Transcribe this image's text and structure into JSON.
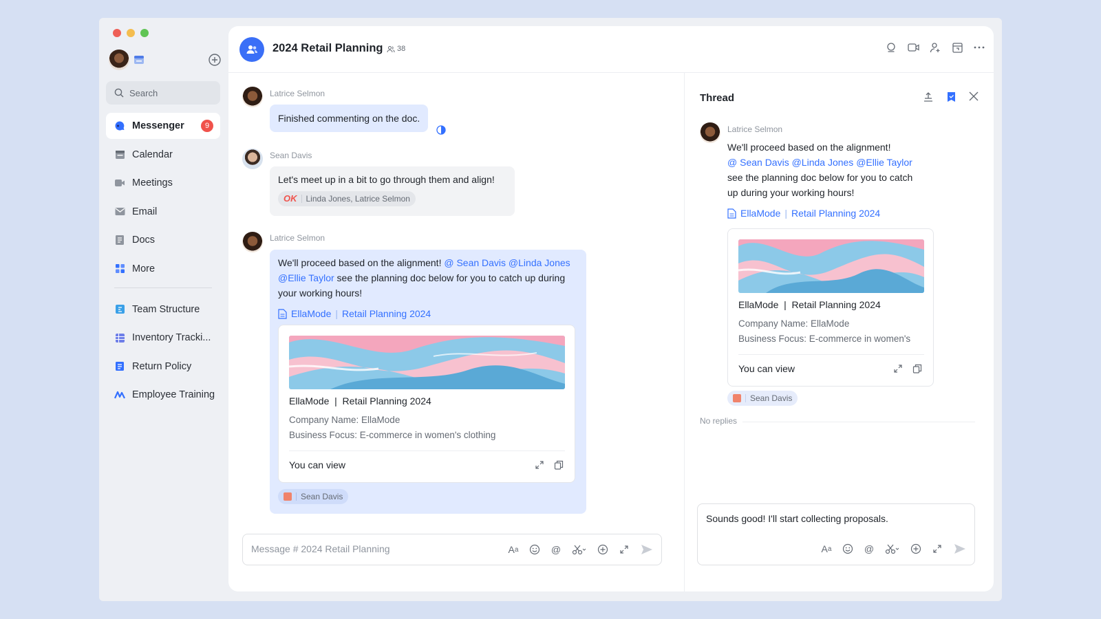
{
  "window": {
    "traffic_colors": [
      "#ee5f57",
      "#f4bd4f",
      "#5fc454"
    ]
  },
  "sidebar": {
    "search_placeholder": "Search",
    "items": [
      {
        "label": "Messenger",
        "icon": "messenger-icon",
        "badge": "9",
        "active": true
      },
      {
        "label": "Calendar",
        "icon": "calendar-icon"
      },
      {
        "label": "Meetings",
        "icon": "video-icon"
      },
      {
        "label": "Email",
        "icon": "mail-icon"
      },
      {
        "label": "Docs",
        "icon": "docs-icon"
      },
      {
        "label": "More",
        "icon": "grid-icon"
      }
    ],
    "pinned": [
      {
        "label": "Team Structure",
        "icon": "org-icon"
      },
      {
        "label": "Inventory Tracki...",
        "icon": "sheet-icon"
      },
      {
        "label": "Return Policy",
        "icon": "doc-icon"
      },
      {
        "label": "Employee Training",
        "icon": "training-icon"
      }
    ]
  },
  "header": {
    "title": "2024 Retail Planning",
    "member_count": "38"
  },
  "messages": {
    "m1": {
      "sender": "Latrice Selmon",
      "text": "Finished commenting on the doc."
    },
    "m2": {
      "sender": "Sean Davis",
      "text": "Let's meet up in a bit to go through them and align!",
      "reaction_emoji": "OK",
      "reaction_users": "Linda Jones, Latrice Selmon"
    },
    "m3": {
      "sender": "Latrice Selmon",
      "text_1": "We'll proceed based on the alignment! ",
      "mention_1": "@ Sean Davis",
      "mention_2": " @Linda Jones",
      "mention_3": "@Ellie Taylor",
      "text_2": " see the planning doc below for you to catch up during",
      "text_3": "your working hours!",
      "doc_link_a": "EllaMode",
      "doc_link_sep": "|",
      "doc_link_b": "Retail Planning 2024",
      "card": {
        "title": "EllaMode  |  Retail Planning 2024",
        "line_1": "Company Name: EllaMode",
        "line_2": "Business Focus: E-commerce in women's clothing",
        "permission": "You can view"
      },
      "reaction_user": "Sean Davis"
    }
  },
  "composer": {
    "placeholder": "Message # 2024 Retail Planning"
  },
  "thread": {
    "title": "Thread",
    "sender": "Latrice Selmon",
    "line_1": "We'll proceed based on the alignment!",
    "mentions": "@ Sean Davis @Linda Jones @Ellie Taylor",
    "line_2": "see the planning doc below for you to catch",
    "line_3": "up during your working hours!",
    "doc_link_a": "EllaMode",
    "doc_link_sep": "|",
    "doc_link_b": "Retail Planning 2024",
    "card": {
      "title": "EllaMode  |  Retail Planning 2024",
      "line_1": "Company Name: EllaMode",
      "line_2": "Business Focus: E-commerce in women's",
      "permission": "You can view"
    },
    "reaction_user": "Sean Davis",
    "no_replies": "No replies",
    "reply_value": "Sounds good! I'll start collecting proposals."
  },
  "colors": {
    "accent": "#3370ff",
    "badge": "#f0524b",
    "bubble": "#e1eaff"
  }
}
